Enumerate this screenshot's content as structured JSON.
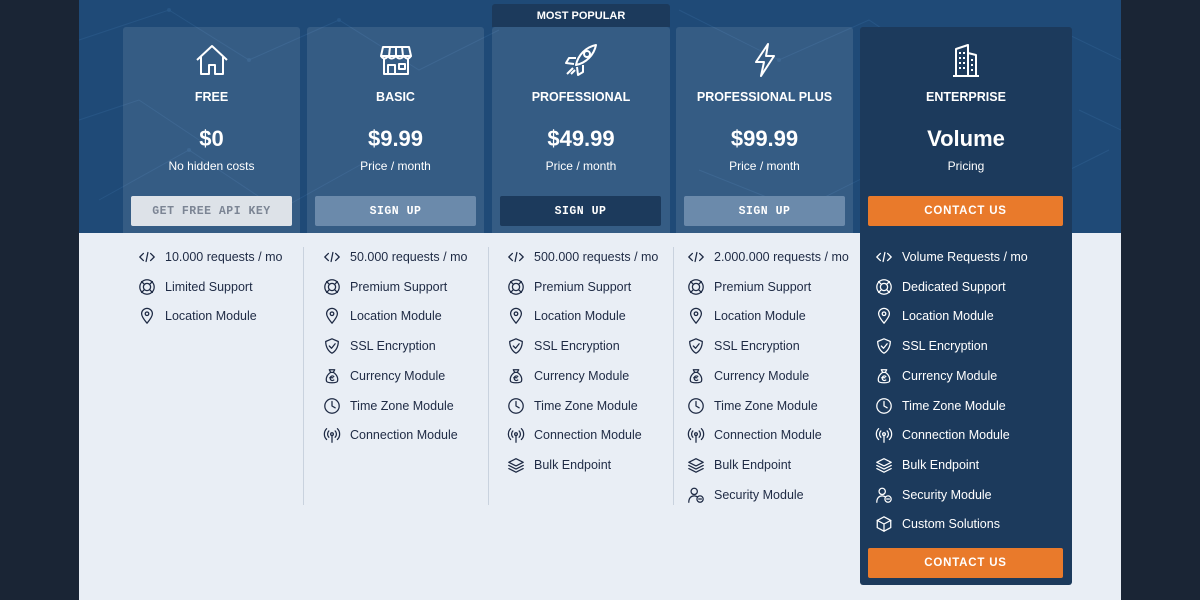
{
  "badge": "MOST POPULAR",
  "colors": {
    "accent": "#e97a2b",
    "dark_navy": "#1c3a5c",
    "hero_blue": "#1f4a77"
  },
  "plans": [
    {
      "icon": "house-icon",
      "name": "FREE",
      "price": "$0",
      "sub": "No hidden costs",
      "button": "GET FREE API KEY",
      "features": [
        "10.000 requests / mo",
        "Limited Support",
        "Location Module"
      ]
    },
    {
      "icon": "storefront-icon",
      "name": "BASIC",
      "price": "$9.99",
      "sub": "Price / month",
      "button": "SIGN UP",
      "features": [
        "50.000 requests / mo",
        "Premium Support",
        "Location Module",
        "SSL Encryption",
        "Currency Module",
        "Time Zone Module",
        "Connection Module"
      ]
    },
    {
      "icon": "rocket-icon",
      "name": "PROFESSIONAL",
      "price": "$49.99",
      "sub": "Price / month",
      "button": "SIGN UP",
      "features": [
        "500.000 requests / mo",
        "Premium Support",
        "Location Module",
        "SSL Encryption",
        "Currency Module",
        "Time Zone Module",
        "Connection Module",
        "Bulk Endpoint"
      ]
    },
    {
      "icon": "lightning-icon",
      "name": "PROFESSIONAL PLUS",
      "price": "$99.99",
      "sub": "Price / month",
      "button": "SIGN UP",
      "features": [
        "2.000.000 requests / mo",
        "Premium Support",
        "Location Module",
        "SSL Encryption",
        "Currency Module",
        "Time Zone Module",
        "Connection Module",
        "Bulk Endpoint",
        "Security Module"
      ]
    },
    {
      "icon": "building-icon",
      "name": "ENTERPRISE",
      "price": "Volume",
      "sub": "Pricing",
      "button": "CONTACT US",
      "button_bottom": "CONTACT US",
      "features": [
        "Volume Requests / mo",
        "Dedicated Support",
        "Location Module",
        "SSL Encryption",
        "Currency Module",
        "Time Zone Module",
        "Connection Module",
        "Bulk Endpoint",
        "Security Module",
        "Custom Solutions"
      ]
    }
  ]
}
